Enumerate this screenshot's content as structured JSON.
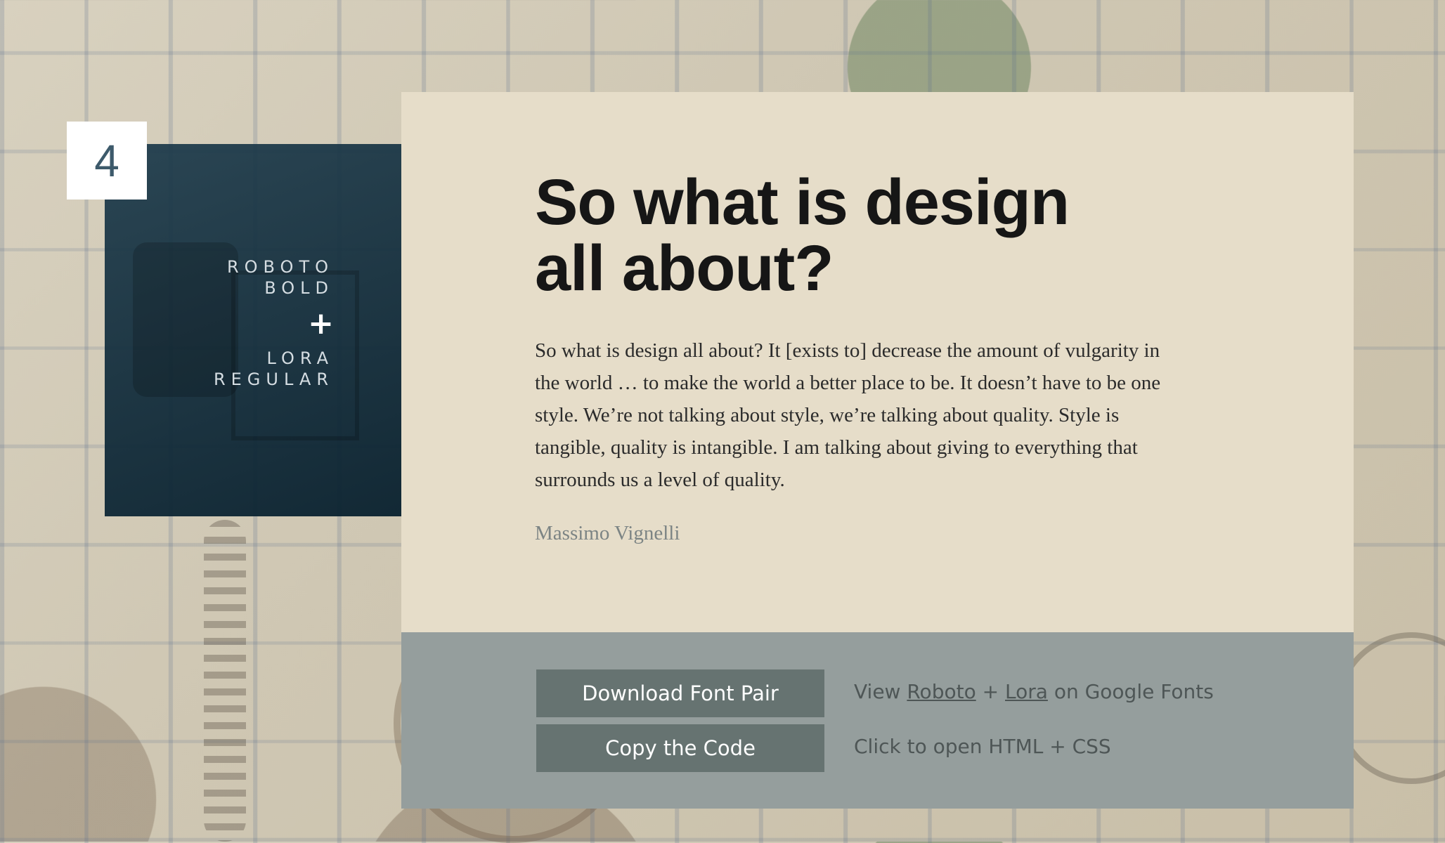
{
  "pair_number": "4",
  "font_pair": {
    "heading_font_line1": "ROBOTO",
    "heading_font_line2": "BOLD",
    "plus": "+",
    "body_font_line1": "LORA",
    "body_font_line2": "REGULAR"
  },
  "card": {
    "title_line1": "So what is design",
    "title_line2": "all about?",
    "quote": "So what is design all about? It [exists to] decrease the amount of vulgarity in the world … to make the world a better place to be. It doesn’t have to be one style. We’re not talking about style, we’re talking about quality. Style is tangible, quality is intangible. I am talking about giving to everything that surrounds us a level of quality.",
    "author": "Massimo Vignelli"
  },
  "footer": {
    "download_button": "Download Font Pair",
    "copy_button": "Copy the Code",
    "view_prefix": "View",
    "link_roboto": "Roboto",
    "plus_sep": "+",
    "link_lora": "Lora",
    "view_suffix": "on Google Fonts",
    "code_hint": "Click to open HTML + CSS"
  },
  "colors": {
    "card_bg": "#e6ddc9",
    "panel_bg": "#0d2a3a",
    "footer_bg": "#959e9d",
    "button_bg": "#667371"
  }
}
